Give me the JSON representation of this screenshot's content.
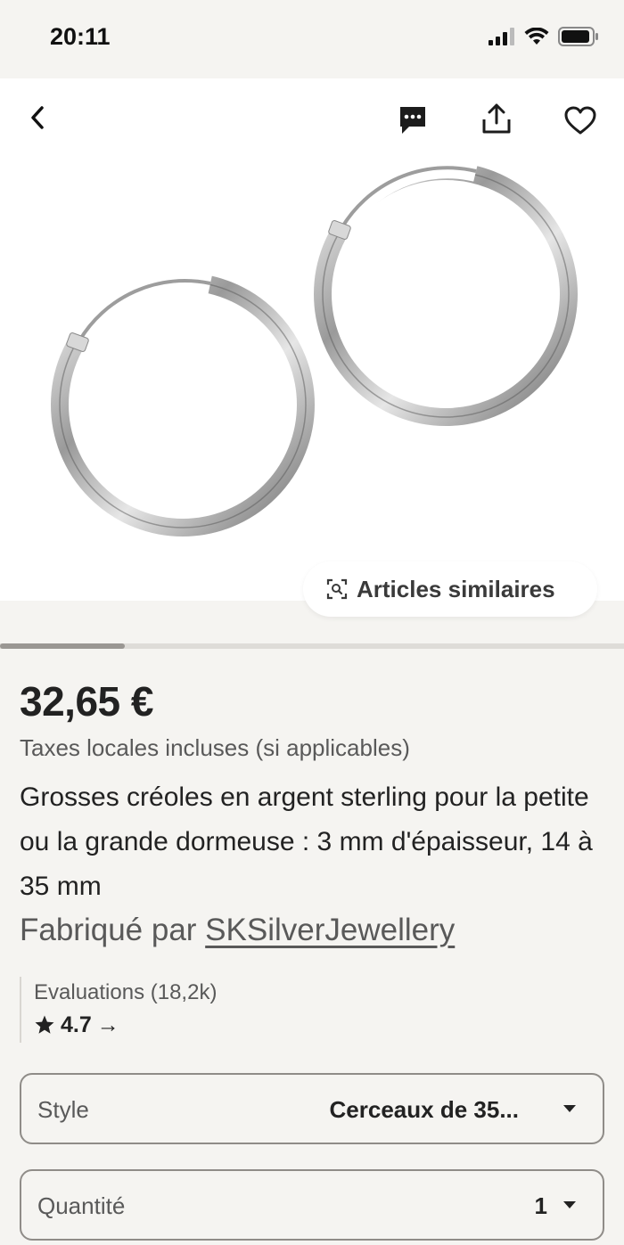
{
  "status_bar": {
    "time": "20:11"
  },
  "gallery": {
    "similar_items_label": "Articles similaires",
    "image_position": 0.2
  },
  "listing": {
    "price": "32,65 €",
    "tax_note": "Taxes locales incluses (si applicables)",
    "title": "Grosses créoles en argent sterling pour la petite ou la grande dormeuse : 3 mm d'épaisseur, 14 à 35 mm",
    "maker_prefix": "Fabriqué par ",
    "shop_name": "SKSilverJewellery"
  },
  "reviews": {
    "label": "Evaluations (18,2k)",
    "rating": "4.7",
    "arrow": "→"
  },
  "options": {
    "style_label": "Style",
    "style_value": "Cerceaux de 35...",
    "quantity_label": "Quantité",
    "quantity_value": "1"
  },
  "icons": {
    "back": "chevron-left-icon",
    "message": "chat-bubble-icon",
    "share": "share-icon",
    "favorite": "heart-icon",
    "similar": "visual-search-icon"
  }
}
